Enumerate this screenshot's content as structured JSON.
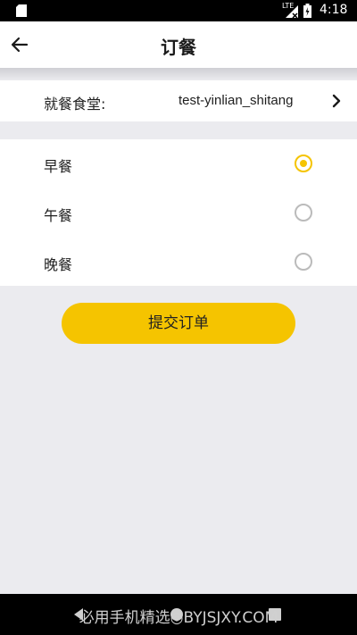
{
  "status_bar": {
    "time": "4:18",
    "network": "LTE"
  },
  "header": {
    "title": "订餐"
  },
  "canteen": {
    "label": "就餐食堂:",
    "value": "test-yinlian_shitang"
  },
  "meals": [
    {
      "label": "早餐",
      "selected": true
    },
    {
      "label": "午餐",
      "selected": false
    },
    {
      "label": "晚餐",
      "selected": false
    }
  ],
  "submit_label": "提交订单",
  "footer": {
    "watermark": "必用手机精选◎BYJSJXY.COM"
  },
  "colors": {
    "accent": "#f5c400",
    "background": "#ebebef"
  }
}
